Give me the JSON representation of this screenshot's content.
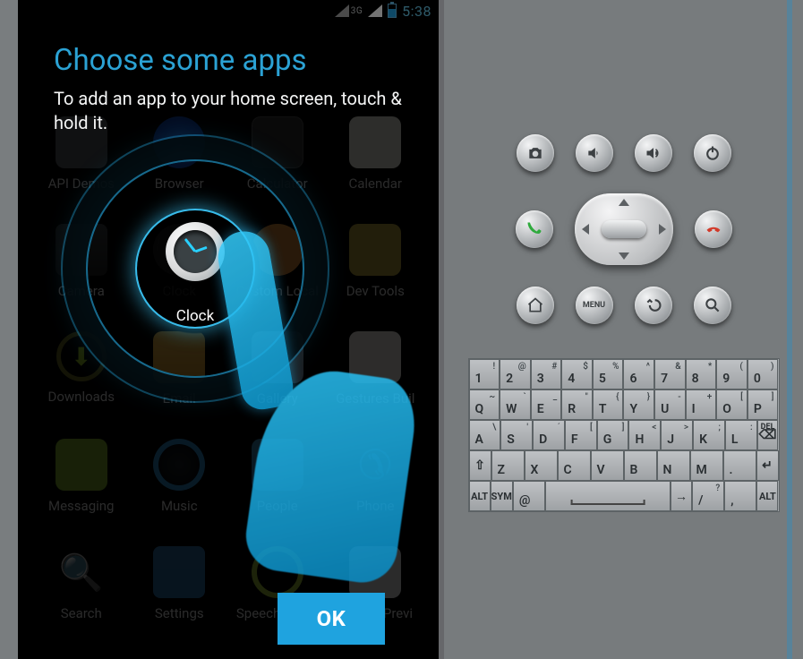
{
  "statusbar": {
    "net_label": "3G",
    "time": "5:38"
  },
  "overlay": {
    "title": "Choose some apps",
    "subtitle": "To add an app to your home screen, touch & hold it.",
    "ok_label": "OK",
    "highlighted_app": "Clock"
  },
  "apps": [
    {
      "id": "api-demos",
      "label": "API Demos"
    },
    {
      "id": "browser",
      "label": "Browser"
    },
    {
      "id": "calculator",
      "label": "Calculator"
    },
    {
      "id": "calendar",
      "label": "Calendar"
    },
    {
      "id": "camera",
      "label": "Camera"
    },
    {
      "id": "clock",
      "label": "Clock"
    },
    {
      "id": "custom-locale",
      "label": "Custom Local"
    },
    {
      "id": "dev-tools",
      "label": "Dev Tools"
    },
    {
      "id": "downloads",
      "label": "Downloads"
    },
    {
      "id": "email",
      "label": "Email"
    },
    {
      "id": "gallery",
      "label": "Gallery"
    },
    {
      "id": "gestures-builder",
      "label": "Gestures Buil"
    },
    {
      "id": "messaging",
      "label": "Messaging"
    },
    {
      "id": "music",
      "label": "Music"
    },
    {
      "id": "people",
      "label": "People"
    },
    {
      "id": "phone",
      "label": "Phone"
    },
    {
      "id": "search",
      "label": "Search"
    },
    {
      "id": "settings",
      "label": "Settings"
    },
    {
      "id": "speech-recorder",
      "label": "Speech Recor"
    },
    {
      "id": "widget-preview",
      "label": "Widget Previ"
    }
  ],
  "emulator_buttons": {
    "row1": [
      {
        "name": "camera-button",
        "icon": "camera"
      },
      {
        "name": "volume-down-button",
        "icon": "vol-down"
      },
      {
        "name": "volume-up-button",
        "icon": "vol-up"
      },
      {
        "name": "power-button",
        "icon": "power"
      }
    ],
    "row2": [
      {
        "name": "call-button",
        "icon": "call"
      },
      {
        "name": "dpad",
        "icon": "dpad"
      },
      {
        "name": "end-call-button",
        "icon": "end"
      }
    ],
    "row3": [
      {
        "name": "home-button",
        "icon": "home"
      },
      {
        "name": "menu-button",
        "icon": "menu",
        "label": "MENU"
      },
      {
        "name": "back-button",
        "icon": "back"
      },
      {
        "name": "search-button",
        "icon": "search"
      }
    ]
  },
  "keyboard": {
    "rows": [
      [
        {
          "p": "1",
          "s": "!"
        },
        {
          "p": "2",
          "s": "@"
        },
        {
          "p": "3",
          "s": "#"
        },
        {
          "p": "4",
          "s": "$"
        },
        {
          "p": "5",
          "s": "%"
        },
        {
          "p": "6",
          "s": "^"
        },
        {
          "p": "7",
          "s": "&"
        },
        {
          "p": "8",
          "s": "*"
        },
        {
          "p": "9",
          "s": "("
        },
        {
          "p": "0",
          "s": ")"
        }
      ],
      [
        {
          "p": "Q",
          "s": "~"
        },
        {
          "p": "W",
          "s": "`"
        },
        {
          "p": "E",
          "s": "_"
        },
        {
          "p": "R",
          "s": "\""
        },
        {
          "p": "T",
          "s": "{"
        },
        {
          "p": "Y",
          "s": "}"
        },
        {
          "p": "U",
          "s": "-"
        },
        {
          "p": "I",
          "s": "+"
        },
        {
          "p": "O",
          "s": "["
        },
        {
          "p": "P",
          "s": "]"
        }
      ],
      [
        {
          "p": "A",
          "s": "\\"
        },
        {
          "p": "S",
          "s": "'"
        },
        {
          "p": "D",
          "s": "ˊ"
        },
        {
          "p": "F",
          "s": "["
        },
        {
          "p": "G",
          "s": "]"
        },
        {
          "p": "H",
          "s": "<"
        },
        {
          "p": "J",
          "s": ">"
        },
        {
          "p": "K",
          "s": ";"
        },
        {
          "p": "L",
          "s": ":"
        },
        {
          "p": "DEL",
          "s": "⌫",
          "special": "del"
        }
      ],
      [
        {
          "p": "⇧",
          "special": "shift"
        },
        {
          "p": "Z"
        },
        {
          "p": "X"
        },
        {
          "p": "C"
        },
        {
          "p": "V"
        },
        {
          "p": "B"
        },
        {
          "p": "N"
        },
        {
          "p": "M"
        },
        {
          "p": "."
        },
        {
          "p": "↵",
          "special": "enter"
        }
      ],
      [
        {
          "p": "ALT",
          "special": "alt"
        },
        {
          "p": "SYM",
          "special": "sym"
        },
        {
          "p": "@",
          "special": "at"
        },
        {
          "p": "",
          "special": "space"
        },
        {
          "p": "→",
          "special": "arrow"
        },
        {
          "p": "/",
          "s": "?"
        },
        {
          "p": ",",
          "s": ""
        },
        {
          "p": "ALT",
          "special": "alt"
        }
      ]
    ]
  }
}
